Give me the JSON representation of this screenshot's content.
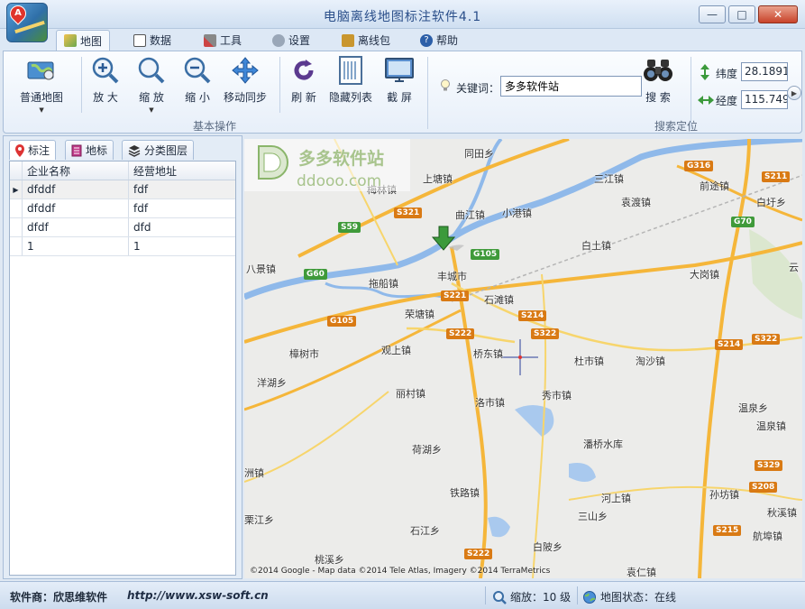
{
  "window": {
    "title": "电脑离线地图标注软件4.1",
    "logo_letter": "A",
    "minimize_icon": "—",
    "maximize_icon": "□",
    "close_icon": "✕"
  },
  "tabs": [
    {
      "label": "地图",
      "icon": "map-icon"
    },
    {
      "label": "数据",
      "icon": "data-icon"
    },
    {
      "label": "工具",
      "icon": "tools-icon"
    },
    {
      "label": "设置",
      "icon": "settings-icon"
    },
    {
      "label": "离线包",
      "icon": "package-icon"
    },
    {
      "label": "帮助",
      "icon": "help-icon"
    }
  ],
  "ribbon": {
    "basic_group_label": "基本操作",
    "search_group_label": "搜索定位",
    "buttons": {
      "normal_map": "普通地图",
      "zoom_in": "放 大",
      "zoom_out": "缩 放",
      "shrink": "缩 小",
      "move_sync": "移动同步",
      "refresh": "刷 新",
      "hide_list": "隐藏列表",
      "screenshot": "截 屏"
    },
    "search": {
      "keyword_label": "关键词：",
      "keyword_value": "多多软件站",
      "search_button": "搜 索"
    },
    "coords": {
      "lat_label": "纬度",
      "lat_value": "28.1891",
      "lng_label": "经度",
      "lng_value": "115.749"
    }
  },
  "left_panel": {
    "tabs": [
      {
        "label": "标注",
        "icon": "pin-icon"
      },
      {
        "label": "地标",
        "icon": "landmark-icon"
      },
      {
        "label": "分类图层",
        "icon": "layers-icon"
      }
    ],
    "columns": [
      "企业名称",
      "经营地址"
    ],
    "rows": [
      [
        "dfddf",
        "fdf"
      ],
      [
        "dfddf",
        "fdf"
      ],
      [
        "dfdf",
        "dfd"
      ],
      [
        "1",
        "1"
      ]
    ],
    "row_pointer": "▶"
  },
  "map": {
    "places": [
      "同田乡",
      "上塘镇",
      "梅林镇",
      "曲江镇",
      "小港镇",
      "三江镇",
      "前途镇",
      "袁渡镇",
      "白圩乡",
      "白土镇",
      "八景镇",
      "丰城市",
      "大岗镇",
      "拖船镇",
      "石滩镇",
      "荣塘镇",
      "樟树市",
      "观上镇",
      "桥东镇",
      "杜市镇",
      "淘沙镇",
      "洋湖乡",
      "丽村镇",
      "洛市镇",
      "秀市镇",
      "温泉乡",
      "温泉镇",
      "荷湖乡",
      "潘桥水库",
      "洲镇",
      "铁路镇",
      "河上镇",
      "孙坊镇",
      "栗江乡",
      "三山乡",
      "秋溪镇",
      "石江乡",
      "航埠镇",
      "桃溪乡",
      "白陂乡",
      "袁仁镇",
      "云"
    ],
    "roads": [
      "S321",
      "S59",
      "G105",
      "G60",
      "S221",
      "S214",
      "S222",
      "S322",
      "G105",
      "G316",
      "S211",
      "G70",
      "S214",
      "S322",
      "S208",
      "S215",
      "S329",
      "S222"
    ],
    "copyright": "©2014 Google - Map data ©2014 Tele Atlas, Imagery ©2014 TerraMetrics",
    "watermark_name": "多多软件站",
    "watermark_url": "ddooo.com"
  },
  "statusbar": {
    "vendor": "软件商：欣思维软件",
    "url": "http://www.xsw-soft.cn",
    "zoom_text": "缩放：10 级",
    "status_text": "地图状态：在线"
  },
  "colors": {
    "accent": "#2b4f8a",
    "river": "#8fb9ea",
    "highway": "#f5b63a",
    "road": "#f7d56c"
  }
}
